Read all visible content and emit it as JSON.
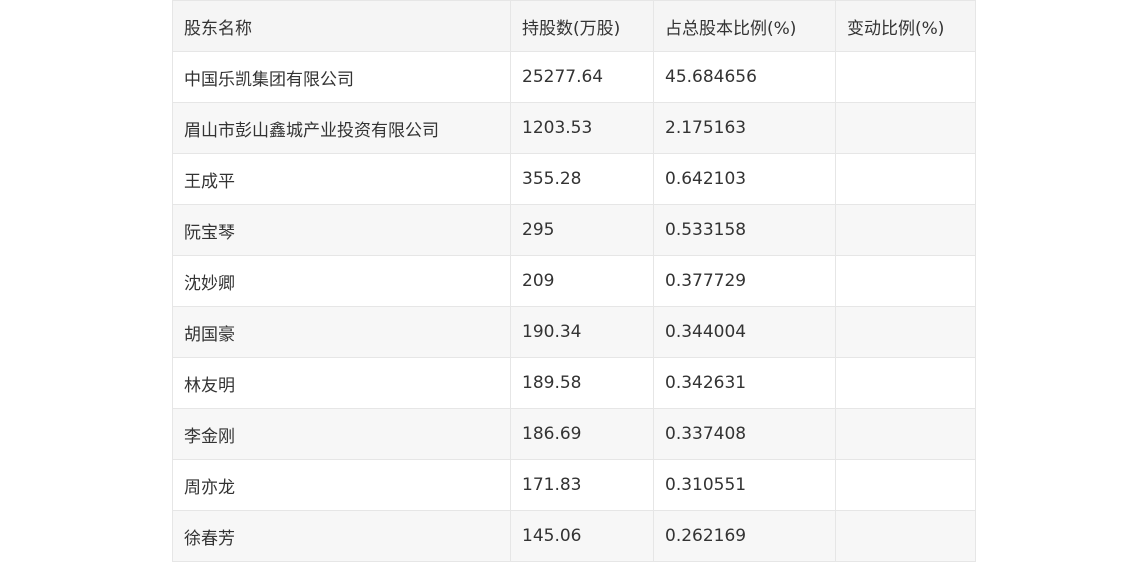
{
  "table": {
    "headers": [
      "股东名称",
      "持股数(万股)",
      "占总股本比例(%)",
      "变动比例(%)"
    ],
    "rows": [
      [
        "中国乐凯集团有限公司",
        "25277.64",
        "45.684656",
        ""
      ],
      [
        "眉山市彭山鑫城产业投资有限公司",
        "1203.53",
        "2.175163",
        ""
      ],
      [
        "王成平",
        "355.28",
        "0.642103",
        ""
      ],
      [
        "阮宝琴",
        "295",
        "0.533158",
        ""
      ],
      [
        "沈妙卿",
        "209",
        "0.377729",
        ""
      ],
      [
        "胡国豪",
        "190.34",
        "0.344004",
        ""
      ],
      [
        "林友明",
        "189.58",
        "0.342631",
        ""
      ],
      [
        "李金刚",
        "186.69",
        "0.337408",
        ""
      ],
      [
        "周亦龙",
        "171.83",
        "0.310551",
        ""
      ],
      [
        "徐春芳",
        "145.06",
        "0.262169",
        ""
      ]
    ]
  },
  "colors": {
    "header_bg": "#f5f5f5",
    "row_alt_bg": "#f7f7f7",
    "border": "#e6e6e6",
    "text": "#333333"
  }
}
